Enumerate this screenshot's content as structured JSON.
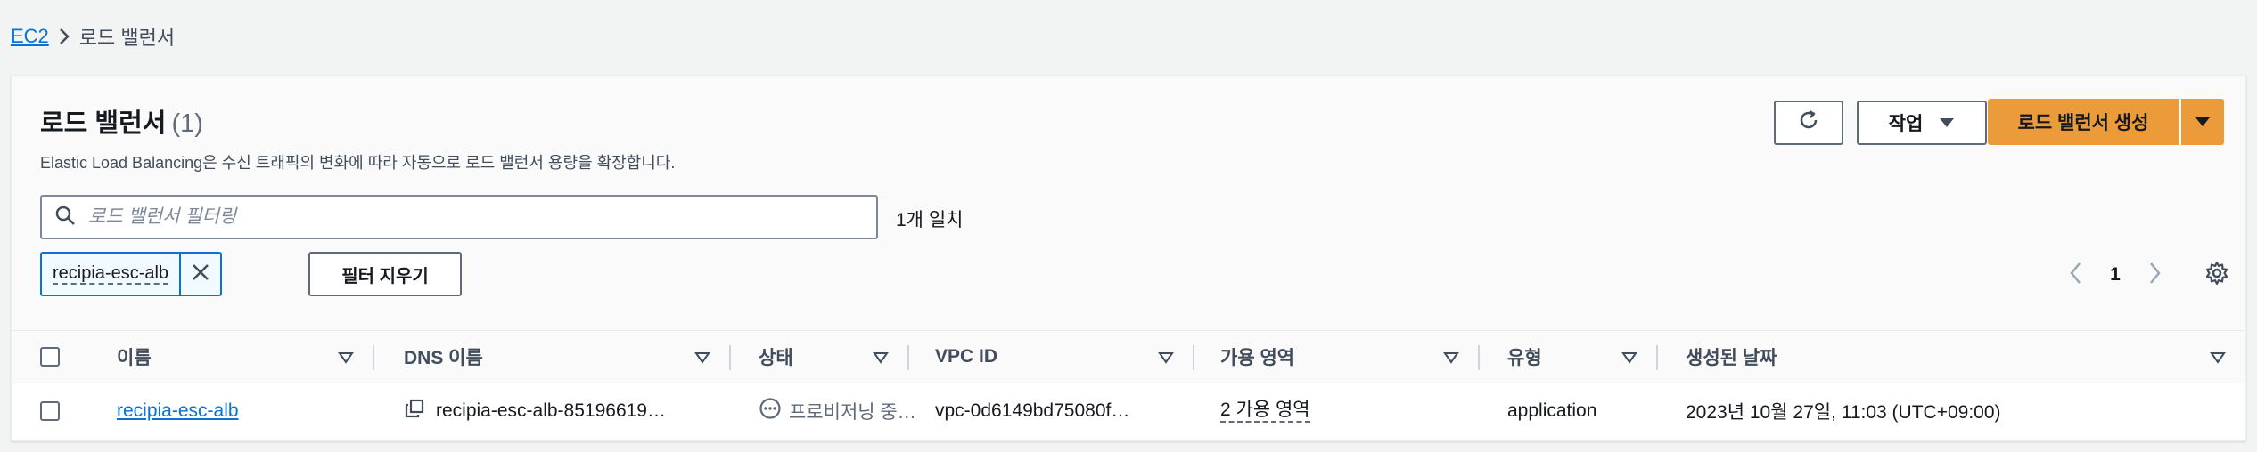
{
  "breadcrumb": {
    "root": "EC2",
    "current": "로드 밸런서"
  },
  "header": {
    "title": "로드 밸런서",
    "count": "(1)",
    "description": "Elastic Load Balancing은 수신 트래픽의 변화에 따라 자동으로 로드 밸런서 용량을 확장합니다."
  },
  "toolbar": {
    "actions_label": "작업",
    "create_label": "로드 밸런서 생성"
  },
  "filter": {
    "placeholder": "로드 밸런서 필터링",
    "match_count": "1개 일치",
    "token": "recipia-esc-alb",
    "clear_label": "필터 지우기"
  },
  "pagination": {
    "current_page": "1"
  },
  "table": {
    "columns": [
      "이름",
      "DNS 이름",
      "상태",
      "VPC ID",
      "가용 영역",
      "유형",
      "생성된 날짜"
    ],
    "rows": [
      {
        "name": "recipia-esc-alb",
        "dns": "recipia-esc-alb-85196619…",
        "status": "프로비저닝 중…",
        "vpc": "vpc-0d6149bd75080f…",
        "az": "2 가용 영역",
        "type": "application",
        "created": "2023년 10월 27일, 11:03 (UTC+09:00)"
      }
    ]
  },
  "colors": {
    "accent": "#0972d3",
    "primary_button": "#ec9b3b",
    "background": "#f2f3f3"
  }
}
